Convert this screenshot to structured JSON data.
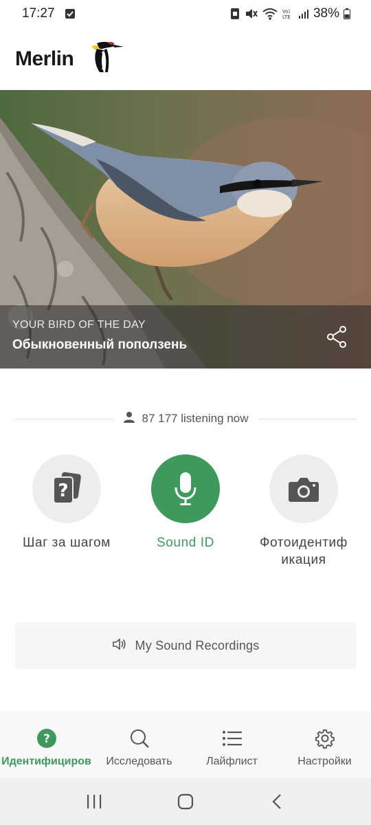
{
  "status_bar": {
    "time": "17:27",
    "battery": "38%"
  },
  "header": {
    "app_name": "Merlin"
  },
  "hero": {
    "kicker": "YOUR BIRD OF THE DAY",
    "bird_name": "Обыкновенный поползень"
  },
  "listening": {
    "text": "87 177 listening now"
  },
  "actions": [
    {
      "label": "Шаг за шагом"
    },
    {
      "label": "Sound ID"
    },
    {
      "label": "Фотоидентиф икация"
    }
  ],
  "recordings": {
    "label": "My Sound Recordings"
  },
  "bottom_nav": [
    {
      "label": "Идентифициров"
    },
    {
      "label": "Исследовать"
    },
    {
      "label": "Лайфлист"
    },
    {
      "label": "Настройки"
    }
  ],
  "colors": {
    "accent": "#3d9a5c",
    "circle_bg": "#eceeed"
  }
}
